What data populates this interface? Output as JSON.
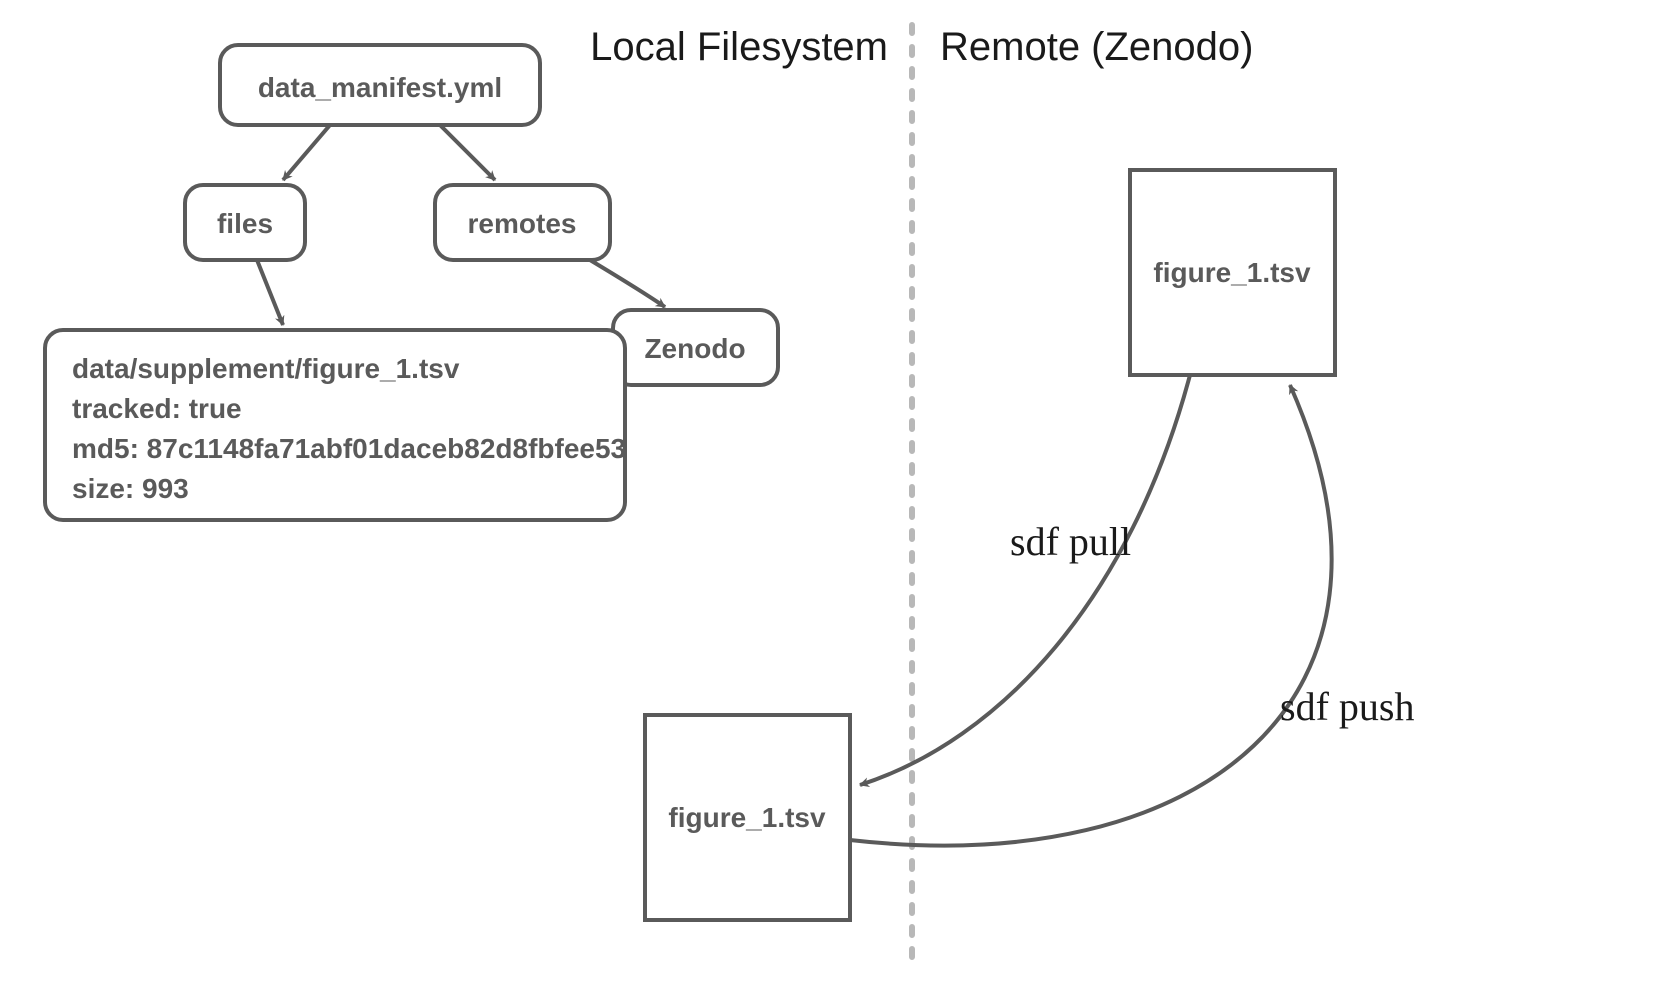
{
  "headings": {
    "local": "Local Filesystem",
    "remote": "Remote (Zenodo)"
  },
  "nodes": {
    "manifest": "data_manifest.yml",
    "files": "files",
    "remotes": "remotes",
    "zenodo": "Zenodo",
    "file_detail": {
      "path": "data/supplement/figure_1.tsv",
      "tracked": "tracked: true",
      "md5": "md5: 87c1148fa71abf01daceb82d8fbfee53",
      "size": "size: 993"
    },
    "local_file": "figure_1.tsv",
    "remote_file": "figure_1.tsv"
  },
  "operations": {
    "pull": "sdf pull",
    "push": "sdf push"
  }
}
